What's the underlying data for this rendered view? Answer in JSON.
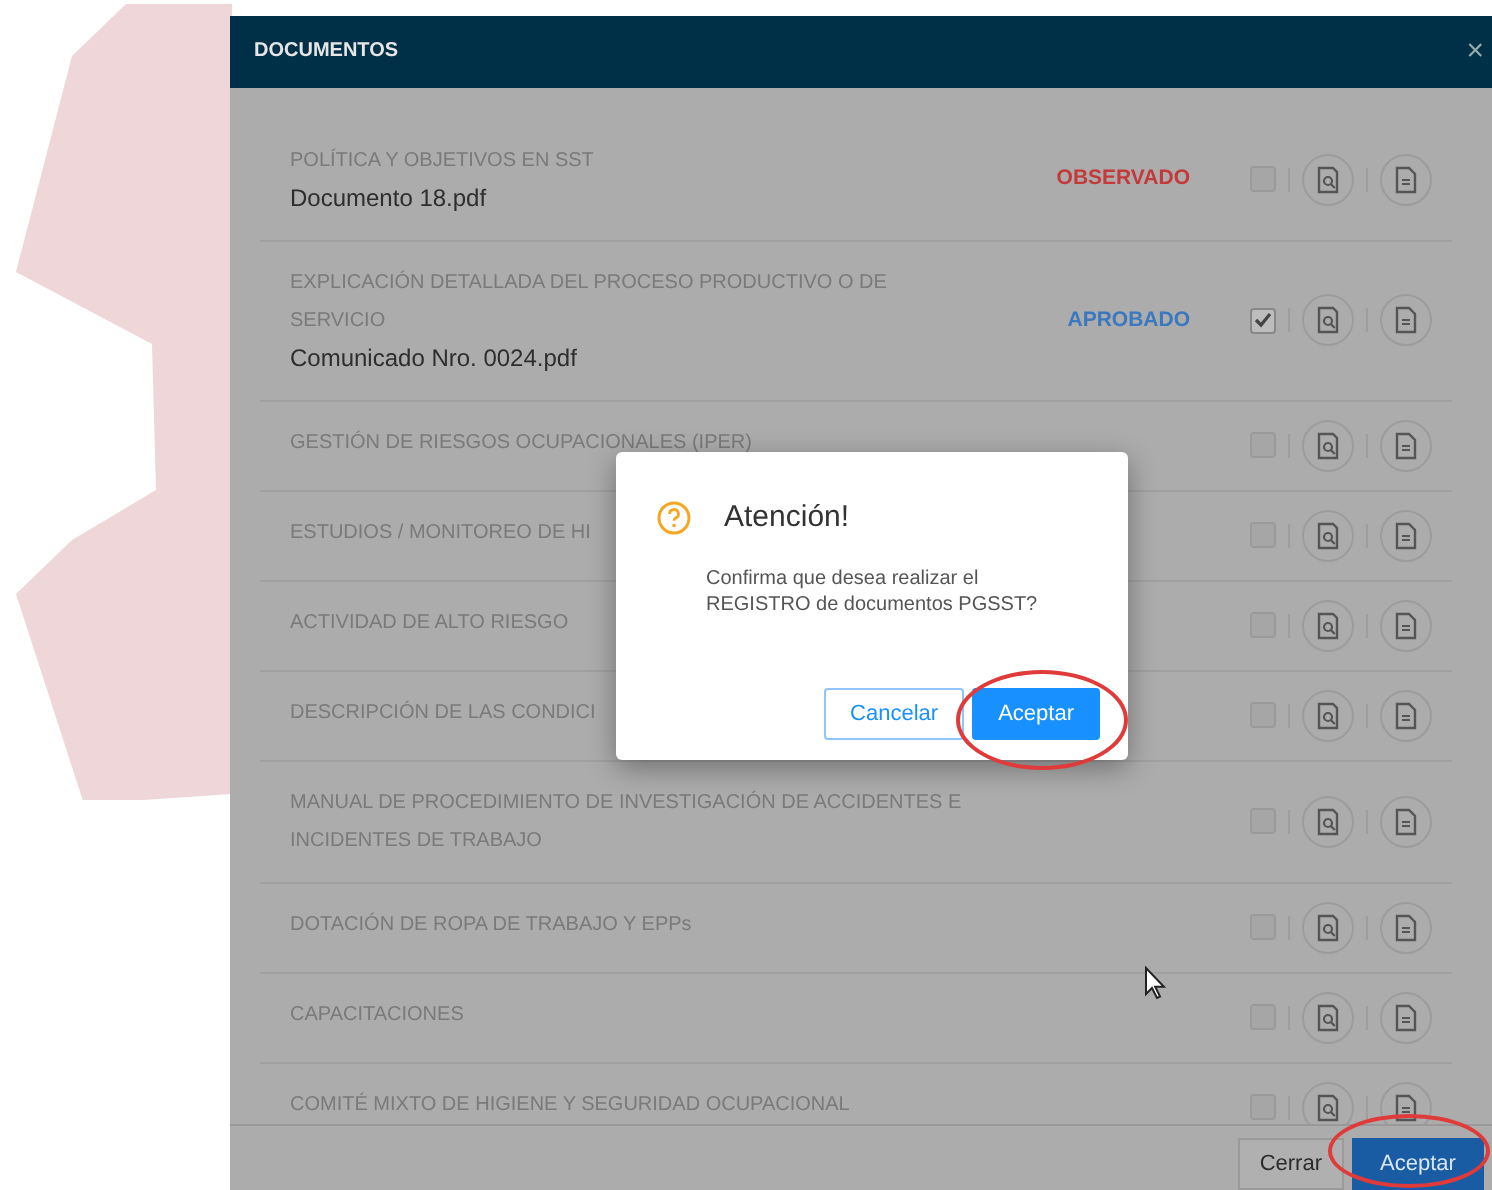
{
  "modal": {
    "title": "DOCUMENTOS",
    "close": "×",
    "rows": [
      {
        "title": "POLÍTICA Y OBJETIVOS EN SST",
        "file": "Documento 18.pdf",
        "status": {
          "kind": "observed",
          "text": "OBSERVADO"
        },
        "checked": false
      },
      {
        "title": "EXPLICACIÓN DETALLADA DEL PROCESO PRODUCTIVO O DE SERVICIO",
        "file": "Comunicado Nro. 0024.pdf",
        "status": {
          "kind": "approved",
          "text": "APROBADO"
        },
        "checked": true
      },
      {
        "title": "GESTIÓN DE RIESGOS OCUPACIONALES (IPER)",
        "checked": false
      },
      {
        "title": "ESTUDIOS / MONITOREO DE HI",
        "checked": false
      },
      {
        "title": "ACTIVIDAD DE ALTO RIESGO",
        "checked": false
      },
      {
        "title": "DESCRIPCIÓN DE LAS CONDICI",
        "checked": false
      },
      {
        "title": "MANUAL DE PROCEDIMIENTO DE INVESTIGACIÓN DE ACCIDENTES E INCIDENTES DE TRABAJO",
        "checked": false
      },
      {
        "title": "DOTACIÓN DE ROPA DE TRABAJO Y EPPs",
        "checked": false
      },
      {
        "title": "CAPACITACIONES",
        "checked": false
      },
      {
        "title": "COMITÉ MIXTO DE HIGIENE Y SEGURIDAD OCUPACIONAL",
        "checked": false
      }
    ],
    "footer": {
      "close_button": "Cerrar",
      "accept_button": "Aceptar"
    }
  },
  "dialog": {
    "title": "Atención!",
    "message": "Confirma que desea realizar el REGISTRO de documentos PGSST?",
    "cancel": "Cancelar",
    "accept": "Aceptar"
  }
}
